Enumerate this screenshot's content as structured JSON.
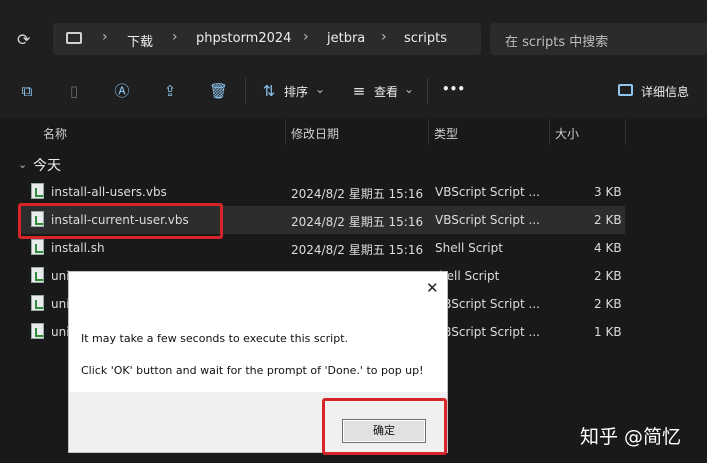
{
  "address_bar": {
    "breadcrumbs": [
      "下载",
      "phpstorm2024",
      "jetbra",
      "scripts"
    ],
    "search_placeholder": "在 scripts 中搜索"
  },
  "toolbar": {
    "sort_label": "排序",
    "view_label": "查看",
    "more_label": "•••",
    "details_label": "详细信息"
  },
  "columns": {
    "name": "名称",
    "date": "修改日期",
    "type": "类型",
    "size": "大小"
  },
  "group": {
    "label": "今天"
  },
  "files": [
    {
      "name": "install-all-users.vbs",
      "date": "2024/8/2 星期五 15:16",
      "type": "VBScript Script ...",
      "size": "3 KB"
    },
    {
      "name": "install-current-user.vbs",
      "date": "2024/8/2 星期五 15:16",
      "type": "VBScript Script ...",
      "size": "2 KB"
    },
    {
      "name": "install.sh",
      "date": "2024/8/2 星期五 15:16",
      "type": "Shell Script",
      "size": "4 KB"
    },
    {
      "name": "uni",
      "date": "",
      "type": "hell Script",
      "size": "2 KB"
    },
    {
      "name": "uni",
      "date": "",
      "type": "VBScript Script ...",
      "size": "2 KB"
    },
    {
      "name": "uni",
      "date": "",
      "type": "VBScript Script ...",
      "size": "1 KB"
    }
  ],
  "dialog": {
    "close_glyph": "✕",
    "message_1": "It may take a few seconds to execute this script.",
    "message_2": "Click 'OK' button and wait for the prompt of 'Done.' to pop up!",
    "ok_label": "确定"
  },
  "watermark": "知乎 @简忆",
  "colors": {
    "highlight_box": "#d6262a",
    "background": "#191919"
  }
}
